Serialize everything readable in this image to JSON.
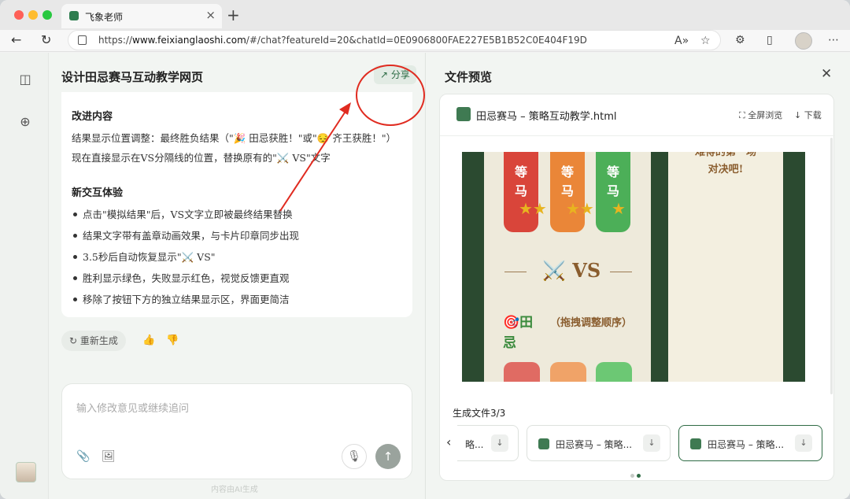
{
  "browser": {
    "tab_title": "飞象老师",
    "url_prefix": "https://",
    "url_domain": "www.feixianglaoshi.com",
    "url_rest": "/#/chat?featureId=20&chatId=0E0906800FAE227E5B1B52C0E404F19D"
  },
  "chat": {
    "title": "设计田忌赛马互动教学网页",
    "share_label": "分享",
    "section1_title": "改进内容",
    "section1_text": "结果显示位置调整：最终胜负结果（\"🎉 田忌获胜！\"或\"😔 齐王获胜！\"）现在直接显示在VS分隔线的位置，替换原有的\"⚔️ VS\"文字",
    "section2_title": "新交互体验",
    "bullets": [
      "点击\"模拟结果\"后，VS文字立即被最终结果替换",
      "结果文字带有盖章动画效果，与卡片印章同步出现",
      "3.5秒后自动恢复显示\"⚔️ VS\"",
      "胜利显示绿色，失败显示红色，视觉反馈更直观",
      "移除了按钮下方的独立结果显示区，界面更简洁"
    ],
    "regenerate_label": "重新生成",
    "input_placeholder": "输入修改意见或继续追问",
    "footer_note": "内容由AI生成"
  },
  "preview": {
    "title": "文件预览",
    "file_name": "田忌赛马 – 策略互动教学.html",
    "fullscreen_label": "全屏浏览",
    "download_label": "下载",
    "game": {
      "horse_chars": [
        "等",
        "马"
      ],
      "vs_text": "⚔️ VS",
      "tianji_line1": "🎯田",
      "tianji_line2": "忌",
      "drag_hint": "（拖拽调整顺序）",
      "right_text_1": "难得的第一场",
      "right_text_2": "对决吧!"
    },
    "generated_label": "生成文件3/3",
    "chips": [
      {
        "label": "略..."
      },
      {
        "label": "田忌赛马 – 策略..."
      },
      {
        "label": "田忌赛马 – 策略..."
      }
    ]
  },
  "colors": {
    "annotation_red": "#e02b20",
    "brand_green": "#2e6b44",
    "horse_red": "#d9453a",
    "horse_orange": "#ea8638",
    "horse_green": "#4caf58"
  }
}
